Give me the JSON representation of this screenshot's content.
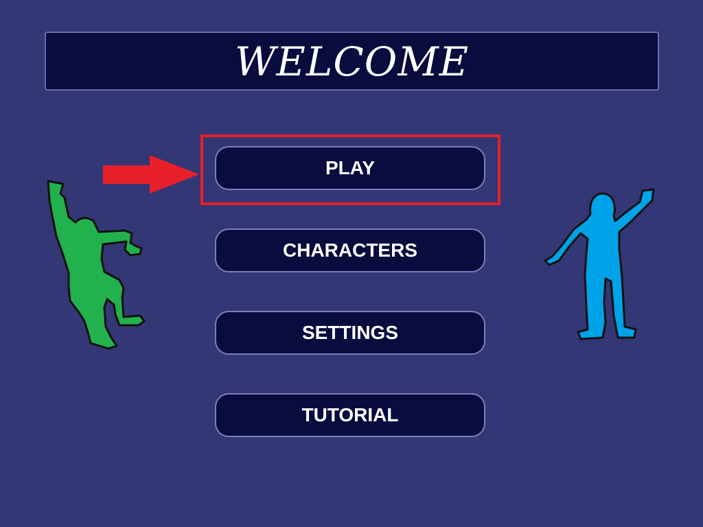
{
  "header": {
    "title": "WELCOME"
  },
  "menu": {
    "items": [
      {
        "id": "play",
        "label": "PLAY",
        "highlighted": true
      },
      {
        "id": "characters",
        "label": "CHARACTERS"
      },
      {
        "id": "settings",
        "label": "SETTINGS"
      },
      {
        "id": "tutorial",
        "label": "TUTORIAL"
      }
    ]
  },
  "annotation": {
    "arrow_icon": "right-arrow-icon",
    "highlight_color": "#e8202a"
  },
  "decorations": {
    "left_figure": {
      "icon": "green-character-icon",
      "color": "#22b14c"
    },
    "right_figure": {
      "icon": "blue-character-icon",
      "color": "#00a2e8"
    }
  },
  "colors": {
    "background": "#333775",
    "panel": "#090c3d",
    "button_border": "#7b7fbc",
    "text": "#ffffff"
  }
}
